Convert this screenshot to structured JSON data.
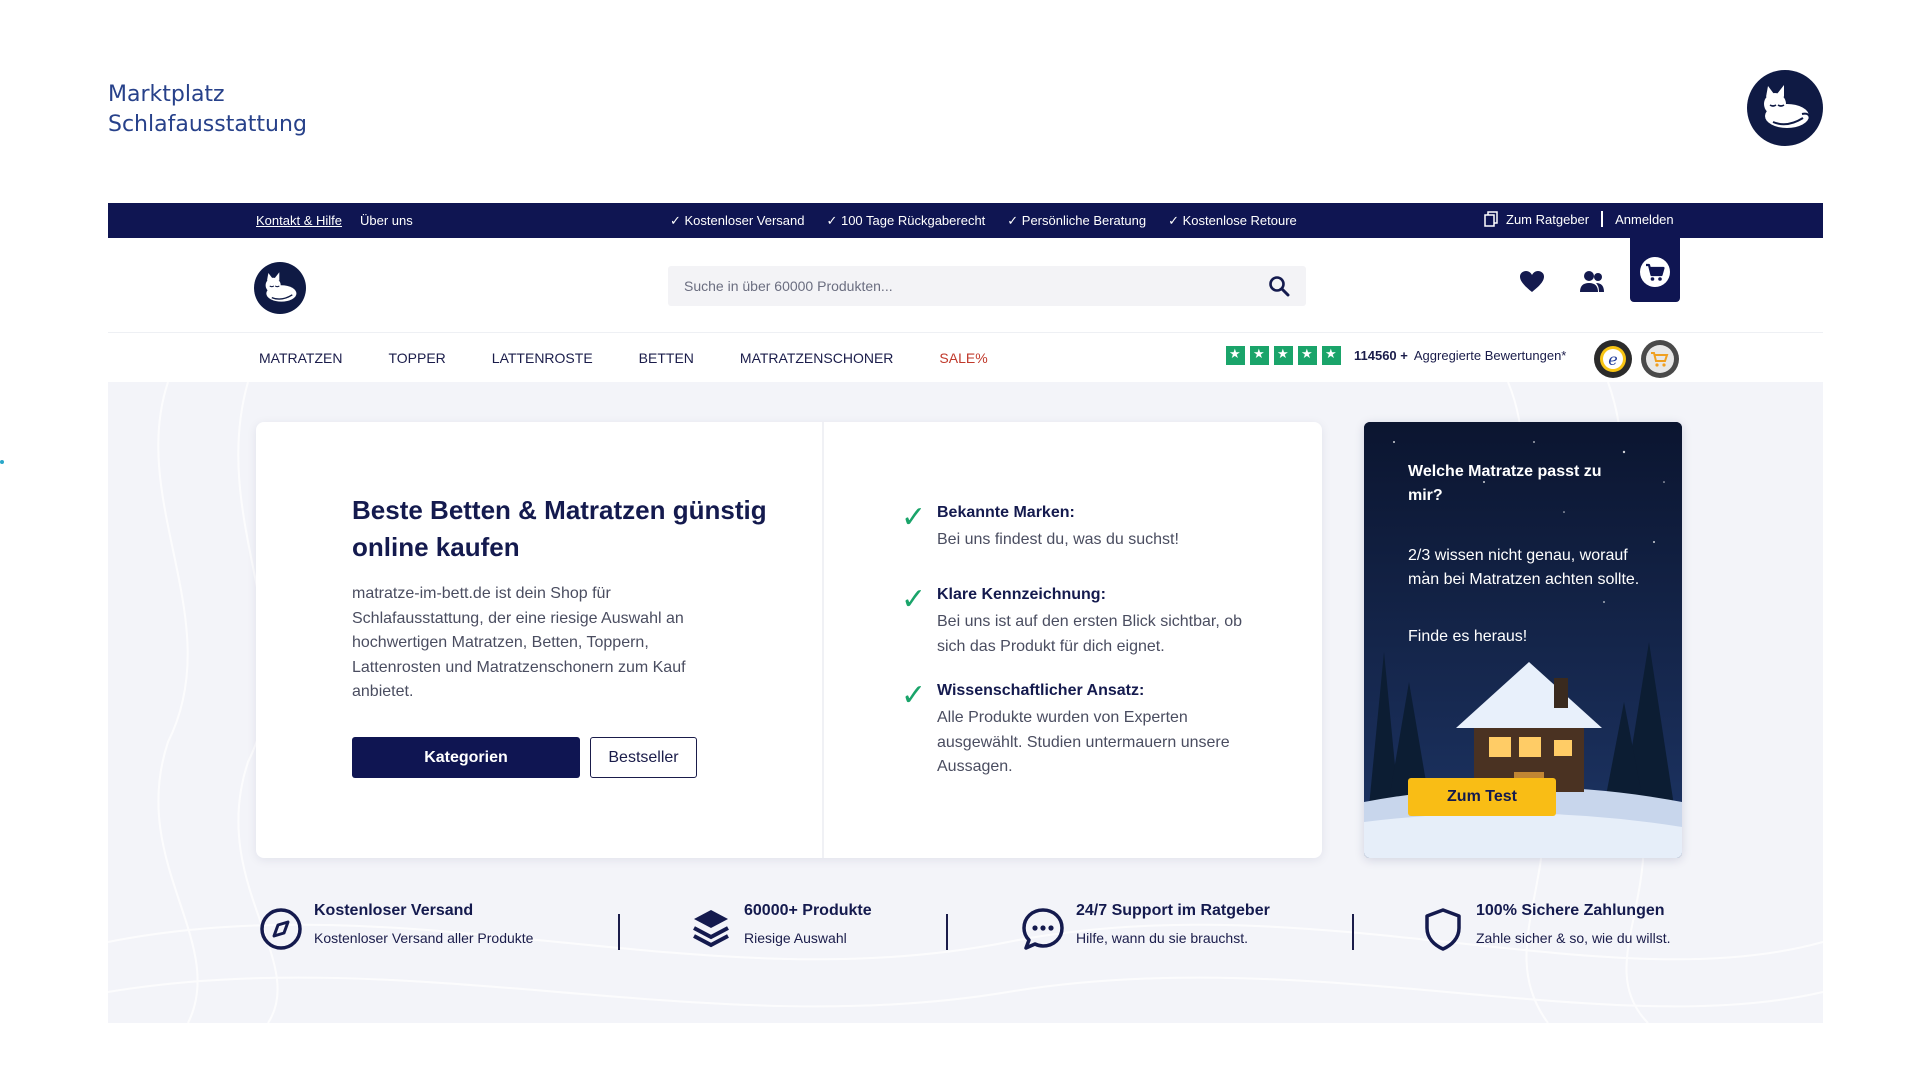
{
  "brand": {
    "line1": "Marktplatz",
    "line2": "Schlafausstattung"
  },
  "topbar": {
    "left": [
      "Kontakt & Hilfe",
      "Über uns"
    ],
    "usps": [
      "✓ Kostenloser Versand",
      "✓ 100 Tage Rückgaberecht",
      "✓ Persönliche Beratung",
      "✓ Kostenlose Retoure"
    ],
    "ratgeber": "Zum Ratgeber",
    "login": "Anmelden"
  },
  "header": {
    "search_placeholder": "Suche in über 60000 Produkten...",
    "icons": [
      "heart-icon",
      "users-icon",
      "cart-icon",
      "search-icon"
    ]
  },
  "nav": {
    "items": [
      "MATRATZEN",
      "TOPPER",
      "LATTENROSTE",
      "BETTEN",
      "MATRATZENSCHONER",
      "SALE%"
    ],
    "rating_count": "114560 +",
    "rating_text": "Aggregierte Bewertungen*"
  },
  "hero": {
    "title": "Beste Betten & Matratzen günstig online kaufen",
    "description": "matratze-im-bett.de ist dein Shop für Schlafausstattung, der eine riesige Auswahl an hochwertigen Matratzen, Betten, Toppern, Lattenrosten und Matratzenschonern zum Kauf anbietet.",
    "btn_primary": "Kategorien",
    "btn_secondary": "Bestseller",
    "features": [
      {
        "title": "Bekannte Marken:",
        "desc": "Bei uns findest du, was du suchst!"
      },
      {
        "title": "Klare Kennzeichnung:",
        "desc": "Bei uns ist auf den ersten Blick sichtbar, ob sich das Produkt für dich eignet."
      },
      {
        "title": "Wissenschaftlicher Ansatz:",
        "desc": "Alle Produkte wurden von Experten ausgewählt. Studien untermauern unsere Aussagen."
      }
    ]
  },
  "promo": {
    "title": "Welche Matratze passt zu mir?",
    "body": "2/3  wissen nicht genau, worauf man bei Matratzen achten sollte.",
    "body2": "Finde es heraus!",
    "cta": "Zum Test"
  },
  "usps": [
    {
      "title": "Kostenloser Versand",
      "desc": "Kostenloser Versand aller Produkte",
      "icon": "compass-icon"
    },
    {
      "title": "60000+ Produkte",
      "desc": "Riesige Auswahl",
      "icon": "layers-icon"
    },
    {
      "title": "24/7 Support im Ratgeber",
      "desc": "Hilfe, wann du sie brauchst.",
      "icon": "chat-icon"
    },
    {
      "title": "100% Sichere Zahlungen",
      "desc": "Zahle sicher & so, wie du willst.",
      "icon": "shield-icon"
    }
  ],
  "colors": {
    "navy": "#0f1552",
    "brand_blue": "#27418a",
    "green": "#1aa46a",
    "yellow": "#f9bd15",
    "sale_red": "#c0392b",
    "hero_bg": "#f3f4f9"
  }
}
